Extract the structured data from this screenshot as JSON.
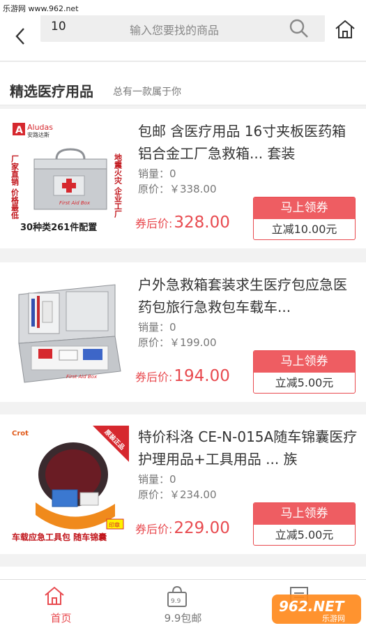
{
  "watermark": {
    "top_text": "乐游网 www.962.net",
    "logo_text": "962.NET",
    "logo_sub": "乐游网"
  },
  "search": {
    "value": "10",
    "placeholder": "输入您要找的商品"
  },
  "section": {
    "title": "精选医疗用品",
    "subtitle": "总有一款属于你"
  },
  "products": [
    {
      "title": "包邮 含医疗用品 16寸夹板医药箱铝合金工厂急救箱... 套装",
      "sales": "销量：0",
      "original_price": "原价：￥338.00",
      "after_label": "券后价:",
      "after_price": "328.00",
      "coupon_button": "马上领券",
      "coupon_value": "立减10.00元",
      "image": {
        "brand": "Aludas",
        "brand_cn": "安路达斯",
        "left_text": "厂家直销 价格最低",
        "right_text": "地震火灾 企业工厂",
        "box_label": "First Aid Box",
        "bottom_text": "30种类261件配置"
      }
    },
    {
      "title": "户外急救箱套装求生医疗包应急医药包旅行急救包车载车...",
      "sales": "销量：0",
      "original_price": "原价：￥199.00",
      "after_label": "券后价:",
      "after_price": "194.00",
      "coupon_button": "马上领券",
      "coupon_value": "立减5.00元",
      "image": {
        "box_label": "First Aid Box"
      }
    },
    {
      "title": "特价科洛 CE-N-015A随车锦囊医疗护理用品+工具用品 ... 族",
      "sales": "销量：0",
      "original_price": "原价：￥234.00",
      "after_label": "券后价:",
      "after_price": "229.00",
      "coupon_button": "马上领券",
      "coupon_value": "立减5.00元",
      "image": {
        "brand": "Crot",
        "corner_badge": "原装正品",
        "stamp": "印章",
        "bottom_text": "车载应急工具包 随车锦囊"
      }
    }
  ],
  "tabs": [
    {
      "label": "首页",
      "icon": "home-icon",
      "active": true
    },
    {
      "label": "9.9包邮",
      "icon": "bag-icon",
      "badge": "9.9",
      "active": false
    },
    {
      "label": "",
      "icon": "list-icon",
      "active": false
    }
  ],
  "colors": {
    "accent": "#e84a4f",
    "coupon_fill": "#ee5d62",
    "background": "#f2f2f2"
  }
}
